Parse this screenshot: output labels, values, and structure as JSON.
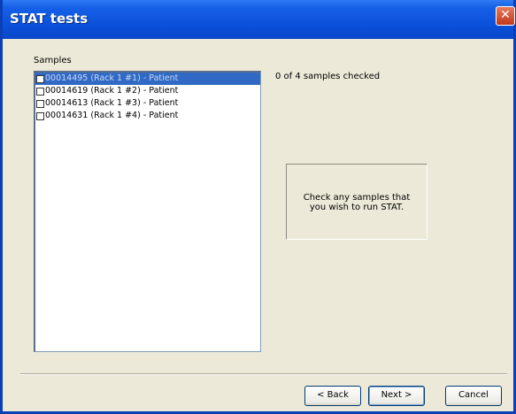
{
  "window": {
    "title": "STAT tests",
    "close_symbol": "✕"
  },
  "samples": {
    "label": "Samples",
    "items": [
      {
        "text": "00014495  (Rack 1 #1) - Patient",
        "selected": true,
        "checked": false
      },
      {
        "text": "00014619  (Rack 1 #2) - Patient",
        "selected": false,
        "checked": false
      },
      {
        "text": "00014613  (Rack 1 #3) - Patient",
        "selected": false,
        "checked": false
      },
      {
        "text": "00014631  (Rack 1 #4) - Patient",
        "selected": false,
        "checked": false
      }
    ]
  },
  "status": {
    "text": "0 of 4 samples checked"
  },
  "hint": {
    "line1": "Check any samples that",
    "line2": "you wish to run STAT."
  },
  "buttons": {
    "back": "< Back",
    "next": "Next >",
    "cancel": "Cancel"
  }
}
